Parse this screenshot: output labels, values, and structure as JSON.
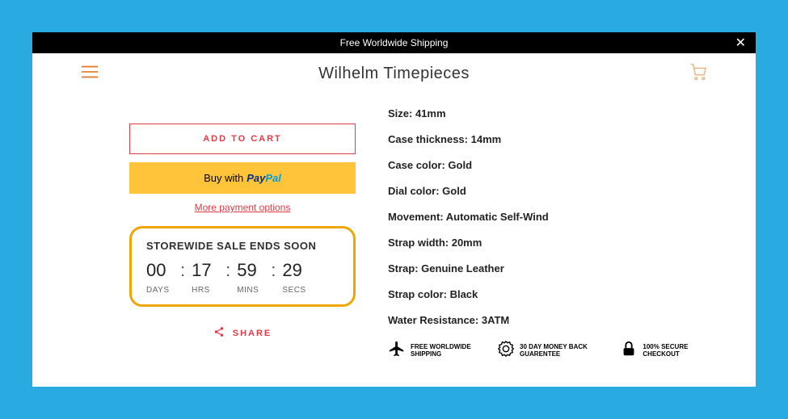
{
  "announcement": {
    "text": "Free Worldwide Shipping"
  },
  "header": {
    "title": "Wilhelm Timepieces"
  },
  "product": {
    "add_to_cart_label": "ADD TO CART",
    "buy_with_label": "Buy with",
    "paypal_part1": "Pay",
    "paypal_part2": "Pal",
    "more_options_label": "More payment options",
    "share_label": "SHARE"
  },
  "countdown": {
    "title": "STOREWIDE SALE ENDS SOON",
    "days": "00",
    "hrs": "17",
    "mins": "59",
    "secs": "29",
    "days_label": "DAYS",
    "hrs_label": "HRS",
    "mins_label": "MINS",
    "secs_label": "SECS"
  },
  "specs": [
    "Size: 41mm",
    "Case thickness: 14mm",
    "Case color: Gold",
    "Dial color: Gold",
    "Movement: Automatic Self-Wind",
    "Strap width: 20mm",
    "Strap: Genuine Leather",
    "Strap color: Black",
    "Water Resistance: 3ATM"
  ],
  "badges": {
    "shipping": "FREE WORLDWIDE SHIPPING",
    "guarantee": "30 DAY MONEY BACK GUARENTEE",
    "secure": "100% SECURE CHECKOUT"
  }
}
